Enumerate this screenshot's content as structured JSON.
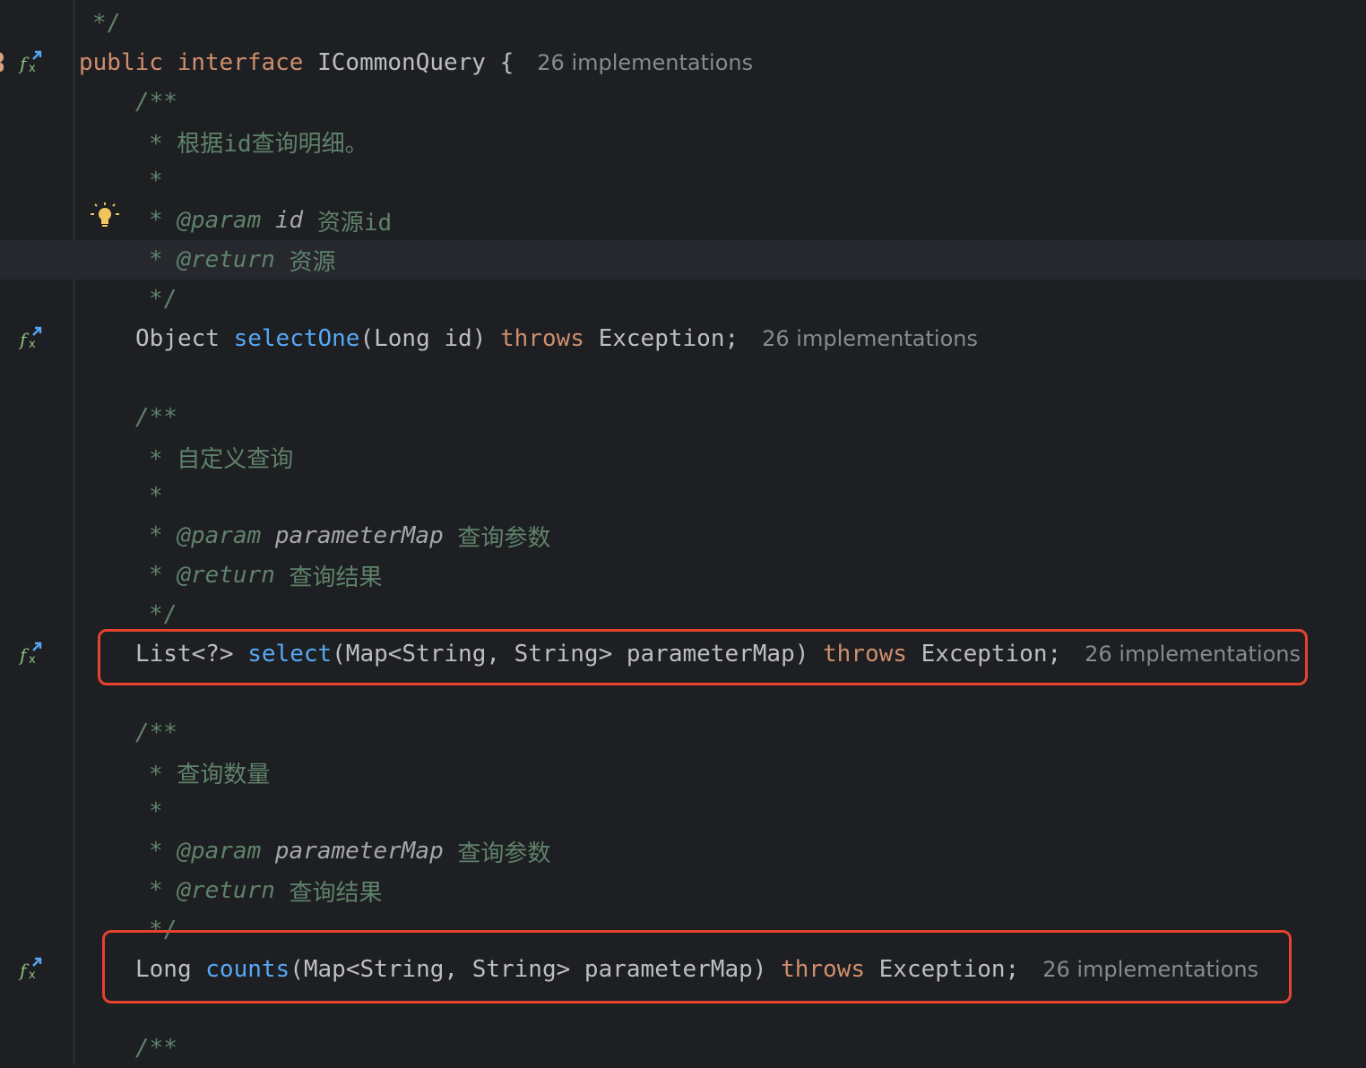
{
  "hints": {
    "implementations": "26 implementations"
  },
  "lines": {
    "l0": "*/",
    "iface_public": "public",
    "iface_interface": "interface",
    "iface_name": "ICommonQuery",
    "iface_brace": "{",
    "doc_open": "/**",
    "doc1_desc": "* 根据id查询明细。",
    "star": "*",
    "doc1_param_tag": "@param",
    "doc1_param_name": "id",
    "doc1_param_desc": "资源id",
    "doc1_return_tag": "@return",
    "doc1_return_desc": "资源",
    "doc_close": "*/",
    "m1_type": "Object",
    "m1_name": "selectOne",
    "m1_args": "(Long id)",
    "throws": "throws",
    "exception": "Exception;",
    "doc2_desc": "* 自定义查询",
    "doc_param_name_map": "parameterMap",
    "doc_param_desc_map": "查询参数",
    "doc_return_desc_result": "查询结果",
    "m2_type": "List<?>",
    "m2_name": "select",
    "m2_args": "(Map<String, String> parameterMap)",
    "doc3_desc": "* 查询数量",
    "m3_type": "Long",
    "m3_name": "counts",
    "m3_args": "(Map<String, String> parameterMap)"
  },
  "colors": {
    "highlight_box": "#e5422f",
    "keyword": "#cf8e6d",
    "method": "#56a8f5",
    "doc_comment": "#5f826b"
  },
  "icons": [
    "implemented-method-gutter-icon",
    "intention-bulb-icon",
    "author-avatar-icon"
  ]
}
